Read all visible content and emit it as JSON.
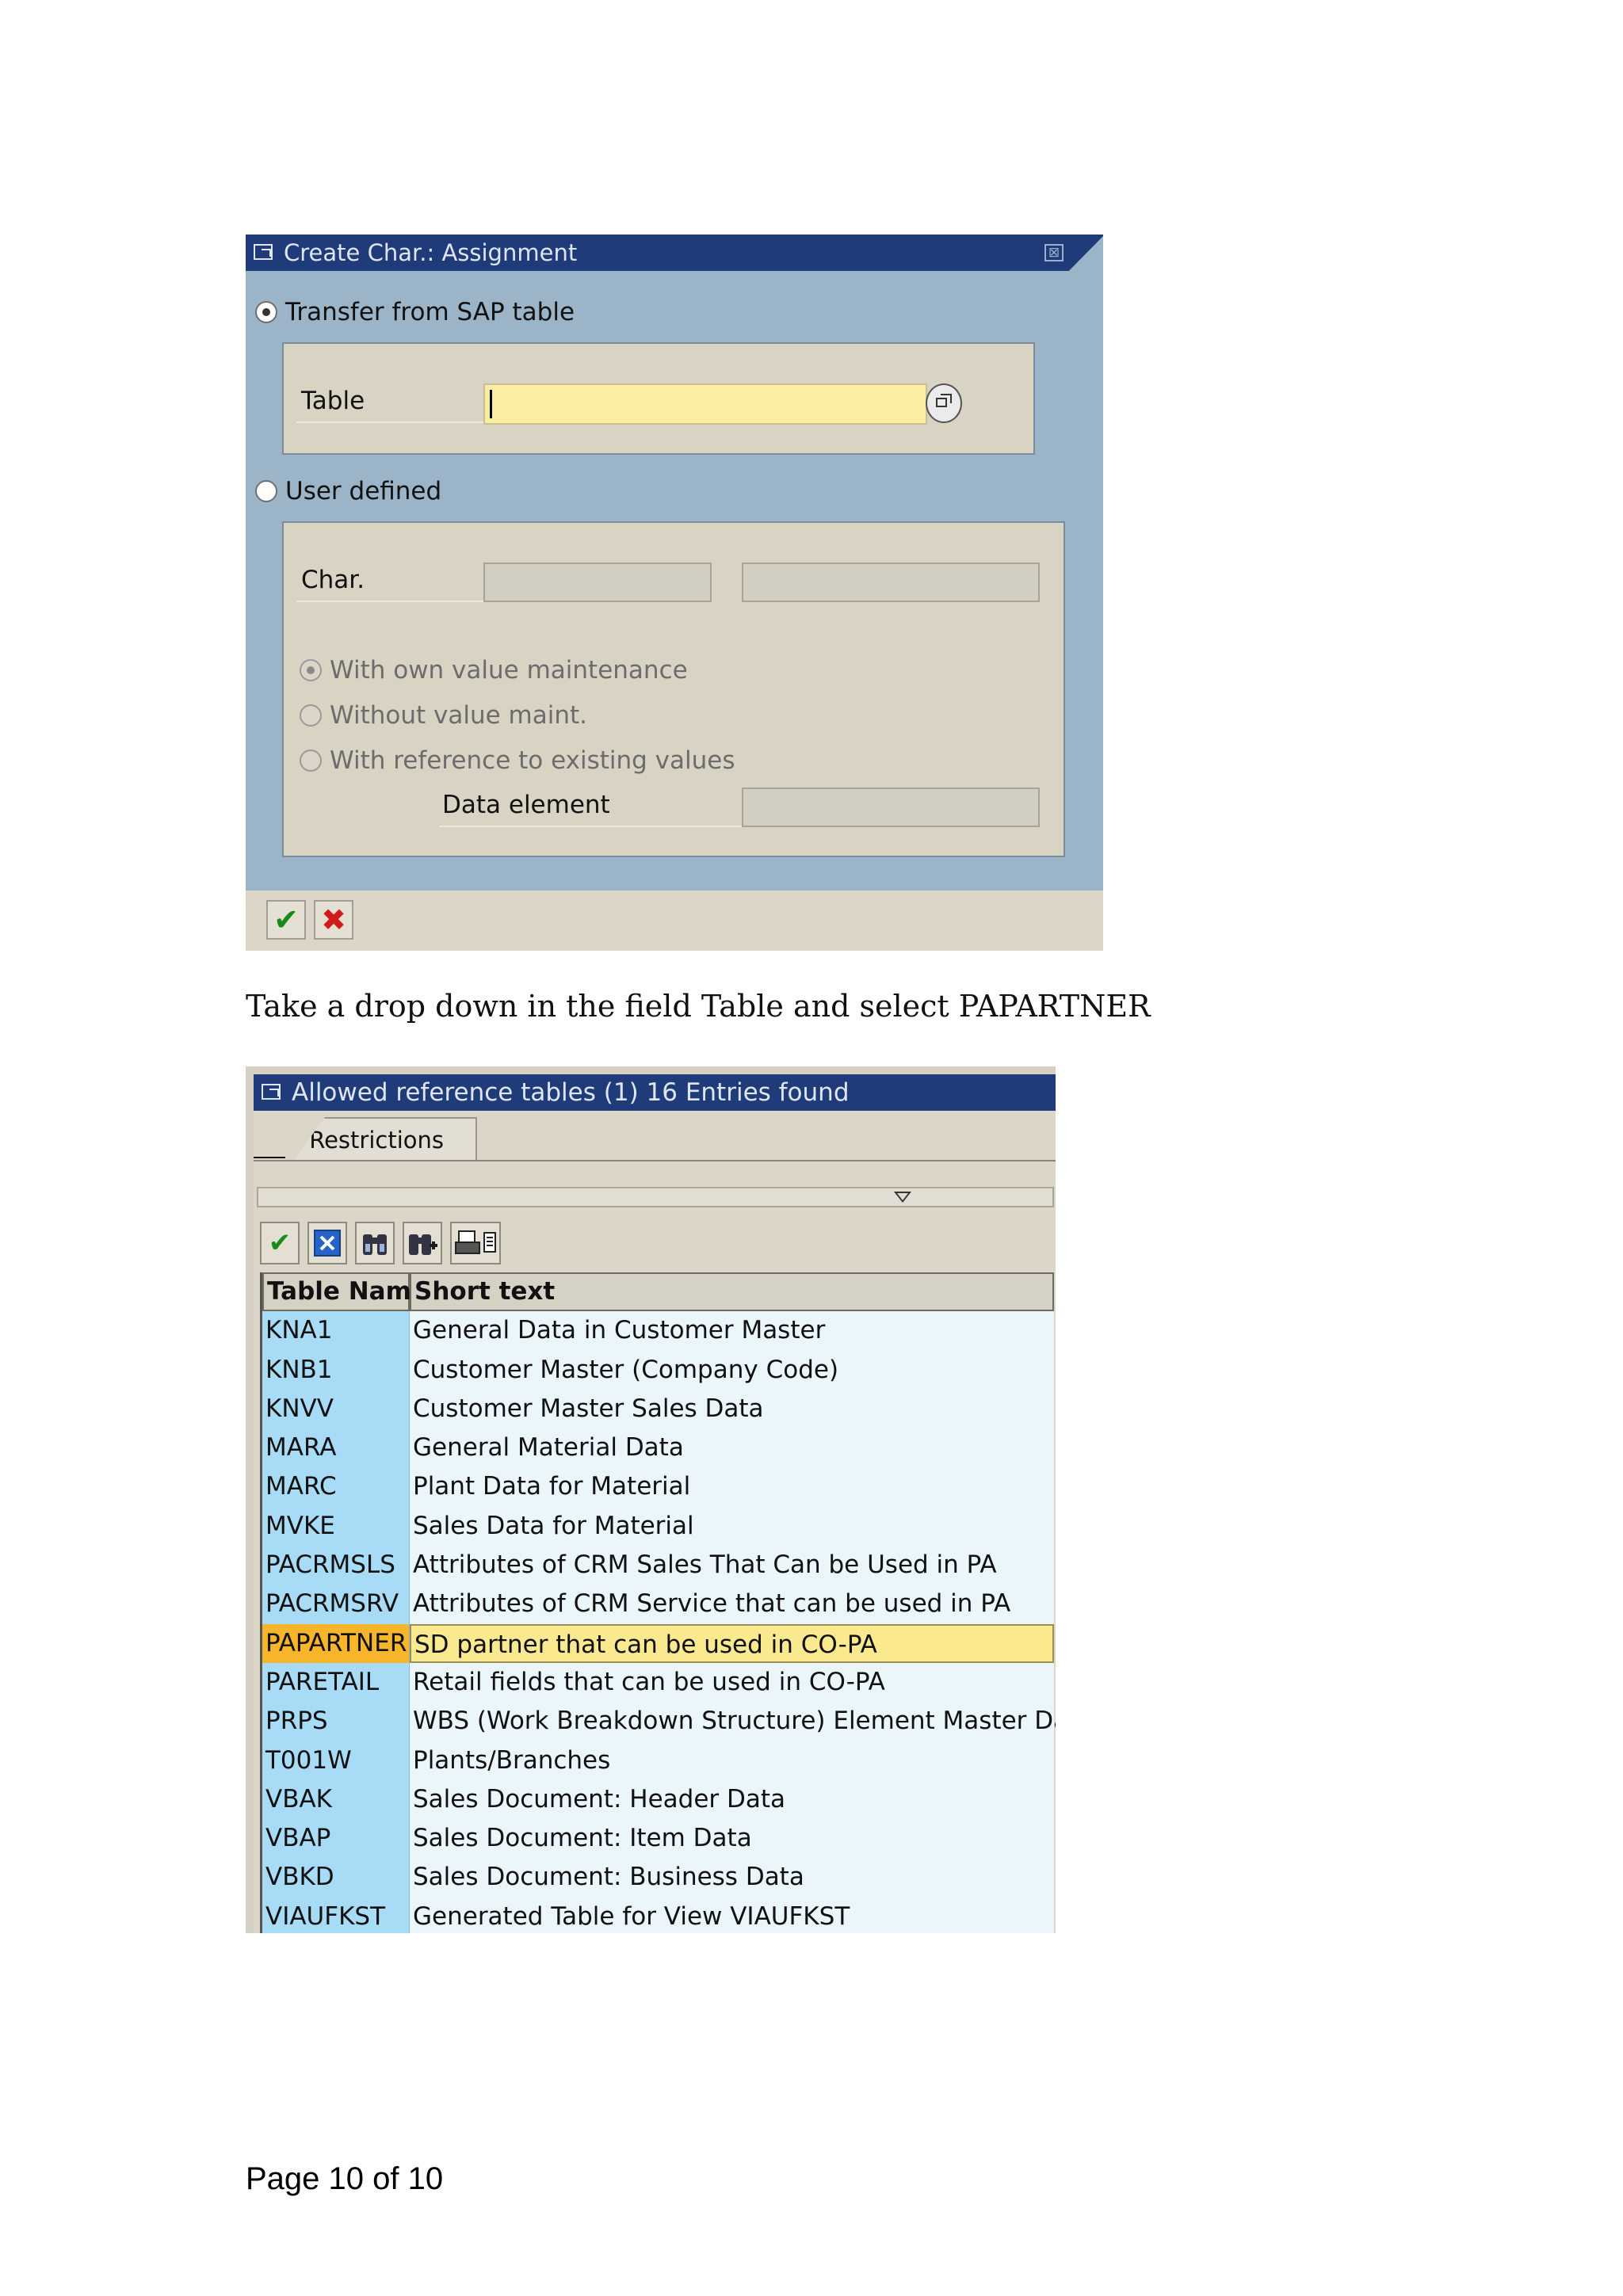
{
  "dialog1": {
    "title": "Create Char.: Assignment",
    "close_symbol": "⊠",
    "radio_transfer_label": "Transfer from SAP table",
    "table_label": "Table",
    "table_value": "",
    "radio_user_label": "User defined",
    "char_label": "Char.",
    "option_own": "With own value maintenance",
    "option_without": "Without value maint.",
    "option_reference": "With reference to existing values",
    "data_element_label": "Data element",
    "ok_symbol": "✔",
    "cancel_symbol": "✖",
    "colors": {
      "title_bg": "#1f3b7a",
      "ok": "#1a8a1a",
      "cancel": "#d11a1a",
      "input": "#fbeea0"
    }
  },
  "instruction": "Take a drop down in the field Table and select PAPARTNER",
  "dialog2": {
    "title": "Allowed reference tables (1)   16 Entries found",
    "tab_label": "Restrictions",
    "toolbar_icons": [
      "check-icon",
      "cancel-icon",
      "find-icon",
      "find-next-icon",
      "print-icon"
    ],
    "columns": [
      "Table Name",
      "Short text"
    ],
    "rows": [
      {
        "name": "KNA1",
        "text": "General Data in Customer Master"
      },
      {
        "name": "KNB1",
        "text": "Customer Master (Company Code)"
      },
      {
        "name": "KNVV",
        "text": "Customer Master Sales Data"
      },
      {
        "name": "MARA",
        "text": "General Material Data"
      },
      {
        "name": "MARC",
        "text": "Plant Data for Material"
      },
      {
        "name": "MVKE",
        "text": "Sales Data for Material"
      },
      {
        "name": "PACRMSLS",
        "text": "Attributes of CRM Sales That Can be Used in PA"
      },
      {
        "name": "PACRMSRV",
        "text": "Attributes of CRM Service that can be used in PA"
      },
      {
        "name": "PAPARTNER",
        "text": "SD partner that can be used in CO-PA"
      },
      {
        "name": "PARETAIL",
        "text": "Retail fields that can be used in CO-PA"
      },
      {
        "name": "PRPS",
        "text": "WBS (Work Breakdown Structure) Element Master Data"
      },
      {
        "name": "T001W",
        "text": "Plants/Branches"
      },
      {
        "name": "VBAK",
        "text": "Sales Document: Header Data"
      },
      {
        "name": "VBAP",
        "text": "Sales Document: Item Data"
      },
      {
        "name": "VBKD",
        "text": "Sales Document: Business Data"
      },
      {
        "name": "VIAUFKST",
        "text": "Generated Table for View VIAUFKST"
      }
    ],
    "selected_row": "PAPARTNER",
    "colors": {
      "name_col": "#a8dcf6",
      "text_col": "#ebf6fb",
      "selected_name": "#f6b52a",
      "selected_text": "#fbe98f"
    }
  },
  "footer": "Page 10 of 10"
}
